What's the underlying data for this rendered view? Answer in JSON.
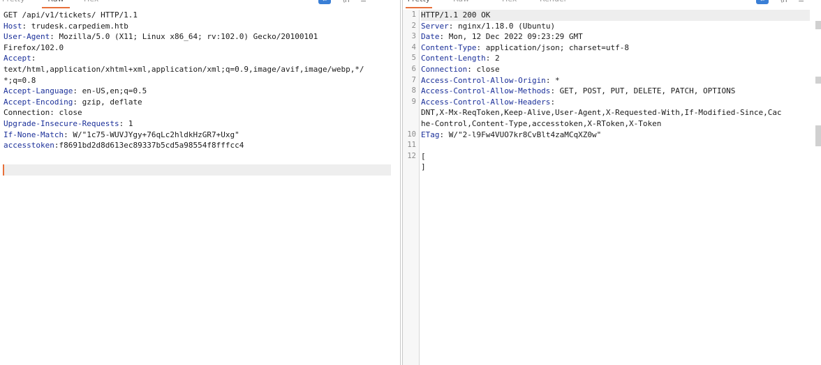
{
  "request": {
    "tabs": [
      "Pretty",
      "Raw",
      "Hex"
    ],
    "active_tab": "Raw",
    "wrap_icon": "wrap-icon",
    "newline_toggle": "\\n",
    "menu_icon": "≡",
    "lines": [
      {
        "text": "GET /api/v1/tickets/ HTTP/1.1"
      },
      {
        "name": "Host",
        "value": " trudesk.carpediem.htb"
      },
      {
        "name": "User-Agent",
        "value": " Mozilla/5.0 (X11; Linux x86_64; rv:102.0) Gecko/20100101"
      },
      {
        "text": "Firefox/102.0"
      },
      {
        "name": "Accept",
        "value": ""
      },
      {
        "text": "text/html,application/xhtml+xml,application/xml;q=0.9,image/avif,image/webp,*/"
      },
      {
        "text": "*;q=0.8"
      },
      {
        "name": "Accept-Language",
        "value": " en-US,en;q=0.5"
      },
      {
        "name": "Accept-Encoding",
        "value": " gzip, deflate"
      },
      {
        "text": "Connection: close"
      },
      {
        "name": "Upgrade-Insecure-Requests",
        "value": " 1"
      },
      {
        "name": "If-None-Match",
        "value": " W/\"1c75-WUVJYgy+76qLc2hldkHzGR7+Uxg\""
      },
      {
        "name": "accesstoken",
        "value": ":f8691bd2d8d613ec89337b5cd5a98554f8fffcc4"
      }
    ]
  },
  "response": {
    "tabs": [
      "Pretty",
      "Raw",
      "Hex",
      "Render"
    ],
    "active_tab": "Pretty",
    "wrap_icon": "wrap-icon",
    "newline_toggle": "\\n",
    "menu_icon": "≡",
    "line_numbers": [
      "1",
      "2",
      "3",
      "4",
      "5",
      "6",
      "7",
      "8",
      "9",
      "",
      "",
      "10",
      "11",
      "12",
      ""
    ],
    "lines": [
      {
        "text": "HTTP/1.1 200 OK"
      },
      {
        "name": "Server",
        "value": ": nginx/1.18.0 (Ubuntu)"
      },
      {
        "name": "Date",
        "value": ": Mon, 12 Dec 2022 09:23:29 GMT"
      },
      {
        "name": "Content-Type",
        "value": ": application/json; charset=utf-8"
      },
      {
        "name": "Content-Length",
        "value": ": 2"
      },
      {
        "name": "Connection",
        "value": ": close"
      },
      {
        "name": "Access-Control-Allow-Origin",
        "value": ": *"
      },
      {
        "name": "Access-Control-Allow-Methods",
        "value": ": GET, POST, PUT, DELETE, PATCH, OPTIONS"
      },
      {
        "name": "Access-Control-Allow-Headers",
        "value": ":"
      },
      {
        "text": "DNT,X-Mx-ReqToken,Keep-Alive,User-Agent,X-Requested-With,If-Modified-Since,Cac"
      },
      {
        "text": "he-Control,Content-Type,accesstoken,X-RToken,X-Token"
      },
      {
        "name": "ETag",
        "value": ": W/\"2-l9Fw4VUO7kr8CvBlt4zaMCqXZ0w\""
      },
      {
        "text": ""
      },
      {
        "text": "["
      },
      {
        "text": "]"
      }
    ]
  }
}
